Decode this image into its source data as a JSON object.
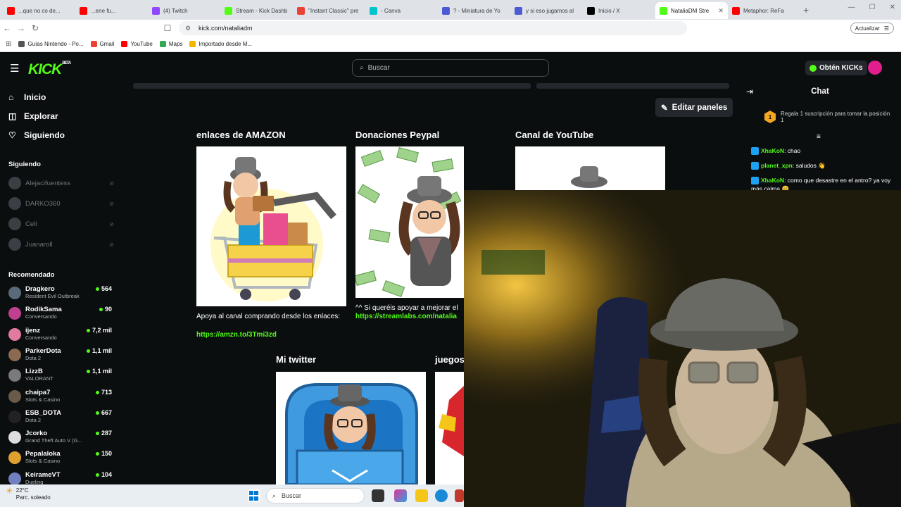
{
  "browser": {
    "tabs": [
      {
        "label": "...que no co de...",
        "icon": "youtube-icon",
        "color": "#ff0000"
      },
      {
        "label": "...ene fu...",
        "icon": "youtube-icon",
        "color": "#ff0000"
      },
      {
        "label": "(4) Twitch",
        "icon": "twitch-icon",
        "color": "#9146ff"
      },
      {
        "label": "Stream - Kick Dashb",
        "icon": "kick-icon",
        "color": "#53fc18"
      },
      {
        "label": "\"Instant Classic\" pre",
        "icon": "gmail-icon",
        "color": "#ea4335"
      },
      {
        "label": "- Canva",
        "icon": "canva-icon",
        "color": "#00c4cc"
      },
      {
        "label": "? - Miniatura de Yo",
        "icon": "shield-icon",
        "color": "#4c5bd4"
      },
      {
        "label": "y si eso jugamos al",
        "icon": "shield-icon",
        "color": "#4c5bd4"
      },
      {
        "label": "Inicio / X",
        "icon": "x-icon",
        "color": "#000000"
      },
      {
        "label": "NataliaDM Stre",
        "icon": "kick-icon",
        "color": "#53fc18"
      },
      {
        "label": "Metaphor: ReFa",
        "icon": "youtube-icon",
        "color": "#ff0000"
      }
    ],
    "active_tab": 9,
    "url": "kick.com/nataliadm",
    "update_label": "Actualizar",
    "bookmarks": [
      {
        "label": "Guías Nintendo - Po...",
        "icon": "globe-icon"
      },
      {
        "label": "Gmail",
        "icon": "gmail-icon"
      },
      {
        "label": "YouTube",
        "icon": "youtube-icon"
      },
      {
        "label": "Maps",
        "icon": "maps-icon"
      },
      {
        "label": "Importado desde M...",
        "icon": "folder-icon"
      }
    ]
  },
  "kick": {
    "logo": "KICK",
    "logo_sup": "BETA",
    "search_placeholder": "Buscar",
    "kicks_button": "Obtén KICKs",
    "nav": [
      {
        "label": "Inicio",
        "icon": "home-icon"
      },
      {
        "label": "Explorar",
        "icon": "compass-icon"
      },
      {
        "label": "Siguiendo",
        "icon": "heart-icon"
      }
    ],
    "following_title": "Siguiendo",
    "following": [
      "Alejacifuentess",
      "DARKO360",
      "Cell",
      "Juanaroll"
    ],
    "recommended_title": "Recomendado",
    "recommended": [
      {
        "name": "Dragkero",
        "game": "Resident Evil Outbreak",
        "viewers": "564",
        "color": "#5a6a7a"
      },
      {
        "name": "RodikSama",
        "game": "Conversando",
        "viewers": "90",
        "color": "#c04090"
      },
      {
        "name": "ijenz",
        "game": "Conversando",
        "viewers": "7,2 mil",
        "color": "#e07aa0"
      },
      {
        "name": "ParkerDota",
        "game": "Dota 2",
        "viewers": "1,1 mil",
        "color": "#8a6a50"
      },
      {
        "name": "LizzB",
        "game": "VALORANT",
        "viewers": "1,1 mil",
        "color": "#7a7a7a"
      },
      {
        "name": "chaipa7",
        "game": "Slots & Casino",
        "viewers": "713",
        "color": "#6a5a4a"
      },
      {
        "name": "ESB_DOTA",
        "game": "Dota 2",
        "viewers": "667",
        "color": "#222222"
      },
      {
        "name": "Jcorko",
        "game": "Grand Theft Auto V (G...",
        "viewers": "287",
        "color": "#dddddd"
      },
      {
        "name": "Pepalaloka",
        "game": "Slots & Casino",
        "viewers": "150",
        "color": "#e0a030"
      },
      {
        "name": "KeirameVT",
        "game": "Dueling",
        "viewers": "104",
        "color": "#7080c0"
      }
    ],
    "edit_panels": "Editar paneles",
    "panels": [
      {
        "title": "enlaces de AMAZON",
        "desc": "Apoya al canal comprando desde los enlaces:",
        "link": "https://amzn.to/3Tmi3zd"
      },
      {
        "title": "Donaciones Peypal",
        "desc": "^^ Si queréis apoyar a mejorar el",
        "link": "https://streamlabs.com/natalia"
      },
      {
        "title": "Canal de YouTube",
        "desc": "",
        "link": ""
      },
      {
        "title": "Mi twitter",
        "desc": "",
        "link": ""
      },
      {
        "title": "juegos",
        "desc": "",
        "link": ""
      }
    ],
    "chat": {
      "title": "Chat",
      "gift_badge": "1",
      "gift_text": "Regala 1 suscripción para tomar la posición 1",
      "messages": [
        {
          "user": "XhaKoN",
          "text": ": chao"
        },
        {
          "user": "planet_xpn",
          "text": ": saludos 👋"
        },
        {
          "user": "XhaKoN",
          "text": ": como que desastre en el antro? ya voy más calma 😊"
        }
      ]
    }
  },
  "taskbar": {
    "temp": "22°C",
    "weather": "Parc. soleado",
    "search_placeholder": "Buscar"
  }
}
